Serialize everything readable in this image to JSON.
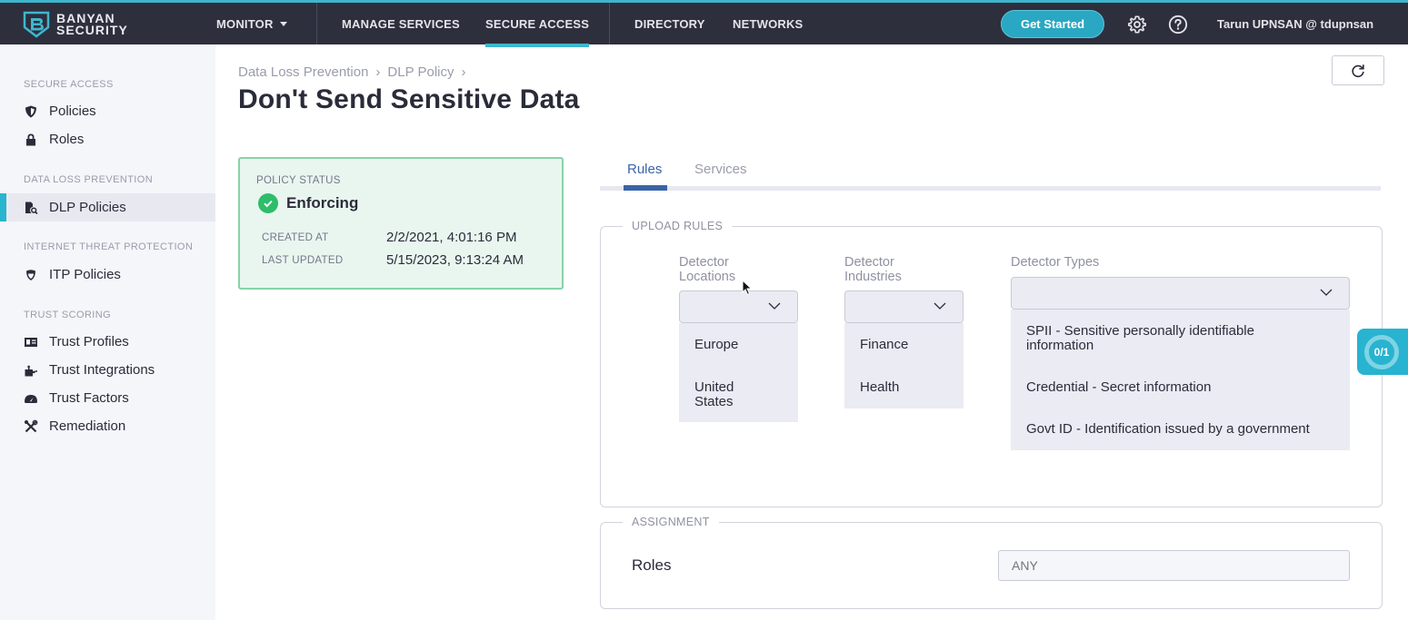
{
  "app": {
    "brand_line1": "BANYAN",
    "brand_line2": "SECURITY",
    "accent_color": "#3fb6cf"
  },
  "topnav": {
    "items": [
      {
        "label": "MONITOR",
        "has_dropdown": true
      },
      {
        "label": "MANAGE SERVICES"
      },
      {
        "label": "SECURE ACCESS",
        "active": true
      },
      {
        "label": "DIRECTORY"
      },
      {
        "label": "NETWORKS"
      }
    ],
    "get_started_label": "Get Started",
    "settings_icon": "gear-icon",
    "help_icon": "question-circle-icon",
    "user": "Tarun UPNSAN @ tdupnsan"
  },
  "sidebar": {
    "sections": [
      {
        "title": "SECURE ACCESS",
        "items": [
          {
            "label": "Policies",
            "icon": "shield-icon"
          },
          {
            "label": "Roles",
            "icon": "lock-icon"
          }
        ]
      },
      {
        "title": "DATA LOSS PREVENTION",
        "items": [
          {
            "label": "DLP Policies",
            "icon": "file-search-icon",
            "active": true
          }
        ]
      },
      {
        "title": "INTERNET THREAT PROTECTION",
        "items": [
          {
            "label": "ITP Policies",
            "icon": "shield-half-icon"
          }
        ]
      },
      {
        "title": "TRUST SCORING",
        "items": [
          {
            "label": "Trust Profiles",
            "icon": "id-card-icon"
          },
          {
            "label": "Trust Integrations",
            "icon": "puzzle-icon"
          },
          {
            "label": "Trust Factors",
            "icon": "gauge-icon"
          },
          {
            "label": "Remediation",
            "icon": "tools-icon"
          }
        ]
      }
    ]
  },
  "breadcrumb": [
    "Data Loss Prevention",
    "DLP Policy"
  ],
  "page_title": "Don't Send Sensitive Data",
  "status_card": {
    "label": "POLICY STATUS",
    "status": "Enforcing",
    "created_at_label": "CREATED AT",
    "created_at": "2/2/2021, 4:01:16 PM",
    "last_updated_label": "LAST UPDATED",
    "last_updated": "5/15/2023, 9:13:24 AM"
  },
  "tabs": [
    {
      "label": "Rules",
      "active": true
    },
    {
      "label": "Services"
    }
  ],
  "upload_rules": {
    "legend": "UPLOAD RULES",
    "locations": {
      "label_line1": "Detector",
      "label_line2": "Locations",
      "value": "",
      "options": [
        [
          "Europe"
        ],
        [
          "United",
          "States"
        ]
      ]
    },
    "industries": {
      "label_line1": "Detector",
      "label_line2": "Industries",
      "value": "",
      "options": [
        [
          "Finance"
        ],
        [
          "Health"
        ]
      ]
    },
    "types": {
      "label": "Detector Types",
      "value": "",
      "options": [
        [
          "SPII - Sensitive personally identifiable",
          "information"
        ],
        [
          "Credential - Secret information"
        ],
        [
          "Govt ID - Identification issued by a government"
        ]
      ]
    }
  },
  "assignment": {
    "legend": "ASSIGNMENT",
    "roles_label": "Roles",
    "roles_placeholder": "ANY"
  },
  "progress_widget": {
    "text": "0/1",
    "completed": 0,
    "total": 1
  }
}
